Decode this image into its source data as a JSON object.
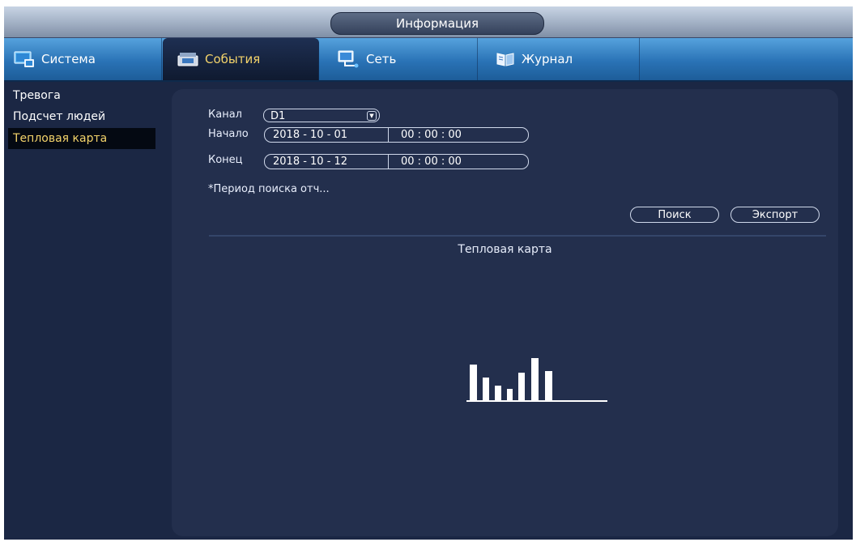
{
  "window": {
    "title": "Информация"
  },
  "tabs": [
    {
      "label": "Система",
      "icon": "monitor-icon"
    },
    {
      "label": "События",
      "icon": "events-icon",
      "active": true
    },
    {
      "label": "Сеть",
      "icon": "network-icon"
    },
    {
      "label": "Журнал",
      "icon": "journal-icon"
    }
  ],
  "sidebar": {
    "items": [
      {
        "label": "Тревога"
      },
      {
        "label": "Подсчет людей"
      },
      {
        "label": "Тепловая карта",
        "active": true
      }
    ]
  },
  "form": {
    "channel_label": "Канал",
    "channel_value": "D1",
    "start_label": "Начало",
    "start_date": "2018 - 10 - 01",
    "start_time": "00 : 00 : 00",
    "end_label": "Конец",
    "end_date": "2018 - 10 - 12",
    "end_time": "00 : 00 : 00",
    "note": "*Период поиска отч..."
  },
  "buttons": {
    "search": "Поиск",
    "export": "Экспорт"
  },
  "heatmap": {
    "title": "Тепловая карта",
    "placeholder_icon": "bar-chart-icon"
  },
  "colors": {
    "background": "#1b2744",
    "panel": "#232f4d",
    "accent": "#f3d36a",
    "tab_blue": "#2a73b6"
  }
}
